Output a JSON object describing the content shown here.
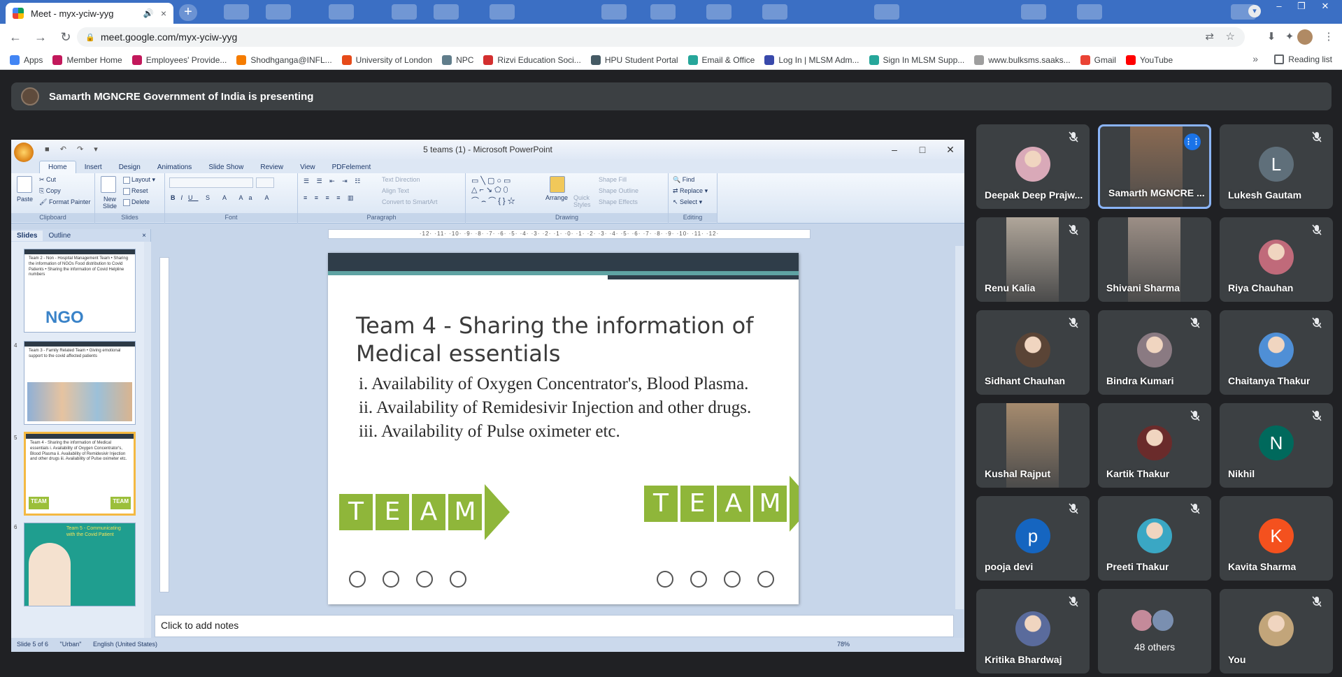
{
  "browser": {
    "tab_title": "Meet - myx-yciw-yyg",
    "tab_close": "×",
    "new_tab": "+",
    "url": "meet.google.com/myx-yciw-yyg",
    "win_min": "–",
    "win_max": "❐",
    "win_close": "✕"
  },
  "bookmarks": {
    "items": [
      {
        "label": "Apps",
        "color": "#4285f4"
      },
      {
        "label": "Member Home",
        "color": "#c2185b"
      },
      {
        "label": "Employees' Provide...",
        "color": "#c2185b"
      },
      {
        "label": "Shodhganga@INFL...",
        "color": "#f57c00"
      },
      {
        "label": "University of London",
        "color": "#e64a19"
      },
      {
        "label": "NPC",
        "color": "#607d8b"
      },
      {
        "label": "Rizvi Education Soci...",
        "color": "#d32f2f"
      },
      {
        "label": "HPU Student Portal",
        "color": "#455a64"
      },
      {
        "label": "Email & Office",
        "color": "#26a69a"
      },
      {
        "label": "Log In | MLSM Adm...",
        "color": "#3949ab"
      },
      {
        "label": "Sign In MLSM Supp...",
        "color": "#26a69a"
      },
      {
        "label": "www.bulksms.saaks...",
        "color": "#9e9e9e"
      },
      {
        "label": "Gmail",
        "color": "#ea4335"
      },
      {
        "label": "YouTube",
        "color": "#ff0000"
      }
    ],
    "more": "»",
    "reading_list": "Reading list"
  },
  "meet": {
    "presenting_text": "Samarth MGNCRE Government of India is presenting"
  },
  "ppt": {
    "window_title": "5 teams (1) - Microsoft PowerPoint",
    "ribbon_tabs": [
      "Home",
      "Insert",
      "Design",
      "Animations",
      "Slide Show",
      "Review",
      "View",
      "PDFelement"
    ],
    "clipboard": {
      "paste": "Paste",
      "cut": "Cut",
      "copy": "Copy",
      "format_painter": "Format Painter",
      "label": "Clipboard"
    },
    "slides_group": {
      "new_slide": "New Slide",
      "layout": "Layout",
      "reset": "Reset",
      "delete": "Delete",
      "label": "Slides"
    },
    "font_label": "Font",
    "paragraph": {
      "text_direction": "Text Direction",
      "align_text": "Align Text",
      "convert": "Convert to SmartArt",
      "label": "Paragraph"
    },
    "drawing": {
      "arrange": "Arrange",
      "quick_styles": "Quick Styles",
      "shape_fill": "Shape Fill",
      "shape_outline": "Shape Outline",
      "shape_effects": "Shape Effects",
      "label": "Drawing"
    },
    "editing": {
      "find": "Find",
      "replace": "Replace",
      "select": "Select",
      "label": "Editing"
    },
    "pane_tabs": {
      "slides": "Slides",
      "outline": "Outline",
      "close": "×"
    },
    "thumbnails": [
      {
        "num": "",
        "text": "Team 2 - Non - Hospital Management Team • Sharing the information of NGOs Food distribution to Covid Patients • Sharing the information of Covid Helpline numbers",
        "badge": "NGO"
      },
      {
        "num": "4",
        "text": "Team 3 - Family Related Team • Giving emotional support to the covid affected patients",
        "badge": ""
      },
      {
        "num": "5",
        "text": "Team 4 - Sharing the information of Medical essentials i. Availability of Oxygen Concentrator's, Blood Plasma ii. Availability of Remidesivir Injection and other drugs iii. Availability of Pulse oximeter etc.",
        "badge": "TEAM"
      },
      {
        "num": "6",
        "text": "Team 5 - Communicating with the Covid Patient",
        "badge": ""
      }
    ],
    "ruler_text": "·12·  ·11·  ·10·  ·9·  ·8·  ·7·  ·6·  ·5·  ·4·  ·3·  ·2·  ·1·  ·0·  ·1·  ·2·  ·3·  ·4·  ·5·  ·6·  ·7·  ·8·  ·9·  ·10·  ·11·  ·12·",
    "slide": {
      "title": "Team 4 - Sharing the information of Medical essentials",
      "items": [
        "i. Availability of Oxygen Concentrator's, Blood Plasma.",
        "ii. Availability of Remidesivir Injection and other drugs.",
        "iii. Availability of Pulse oximeter etc."
      ],
      "team_letters": [
        "T",
        "E",
        "A",
        "M"
      ]
    },
    "notes_placeholder": "Click to add notes",
    "status": {
      "slide": "Slide 5 of 6",
      "theme": "\"Urban\"",
      "language": "English (United States)",
      "zoom": "78%"
    }
  },
  "participants": [
    {
      "name": "Deepak Deep Prajw...",
      "muted": true,
      "kind": "photo",
      "color": "#d9a9b8"
    },
    {
      "name": "Samarth MGNCRE ...",
      "muted": false,
      "kind": "video",
      "color": "#8a6a52",
      "speaking": true
    },
    {
      "name": "Lukesh Gautam",
      "muted": true,
      "kind": "letter",
      "letter": "L",
      "color": "#5f6f7a"
    },
    {
      "name": "Renu Kalia",
      "muted": true,
      "kind": "video",
      "color": "#b0a69a"
    },
    {
      "name": "Shivani Sharma",
      "muted": false,
      "kind": "video",
      "color": "#9c8f86"
    },
    {
      "name": "Riya Chauhan",
      "muted": true,
      "kind": "photo",
      "color": "#c06a7a"
    },
    {
      "name": "Sidhant Chauhan",
      "muted": true,
      "kind": "photo",
      "color": "#5a4436"
    },
    {
      "name": "Bindra Kumari",
      "muted": true,
      "kind": "photo",
      "color": "#8a7a82"
    },
    {
      "name": "Chaitanya Thakur",
      "muted": true,
      "kind": "photo",
      "color": "#4f8fd6"
    },
    {
      "name": "Kushal Rajput",
      "muted": false,
      "kind": "video",
      "color": "#a68b6e"
    },
    {
      "name": "Kartik Thakur",
      "muted": true,
      "kind": "photo",
      "color": "#6a2b2b"
    },
    {
      "name": "Nikhil",
      "muted": true,
      "kind": "letter",
      "letter": "N",
      "color": "#00695c"
    },
    {
      "name": "pooja devi",
      "muted": true,
      "kind": "letter",
      "letter": "p",
      "color": "#1565c0"
    },
    {
      "name": "Preeti Thakur",
      "muted": true,
      "kind": "photo",
      "color": "#3aa7c4"
    },
    {
      "name": "Kavita Sharma",
      "muted": false,
      "kind": "letter",
      "letter": "K",
      "color": "#f4511e"
    },
    {
      "name": "Kritika Bhardwaj",
      "muted": true,
      "kind": "photo",
      "color": "#5a6b9c"
    },
    {
      "name": "48 others",
      "muted": false,
      "kind": "others",
      "color": "#8a7a8a"
    },
    {
      "name": "You",
      "muted": true,
      "kind": "photo",
      "color": "#c2a57a"
    }
  ]
}
